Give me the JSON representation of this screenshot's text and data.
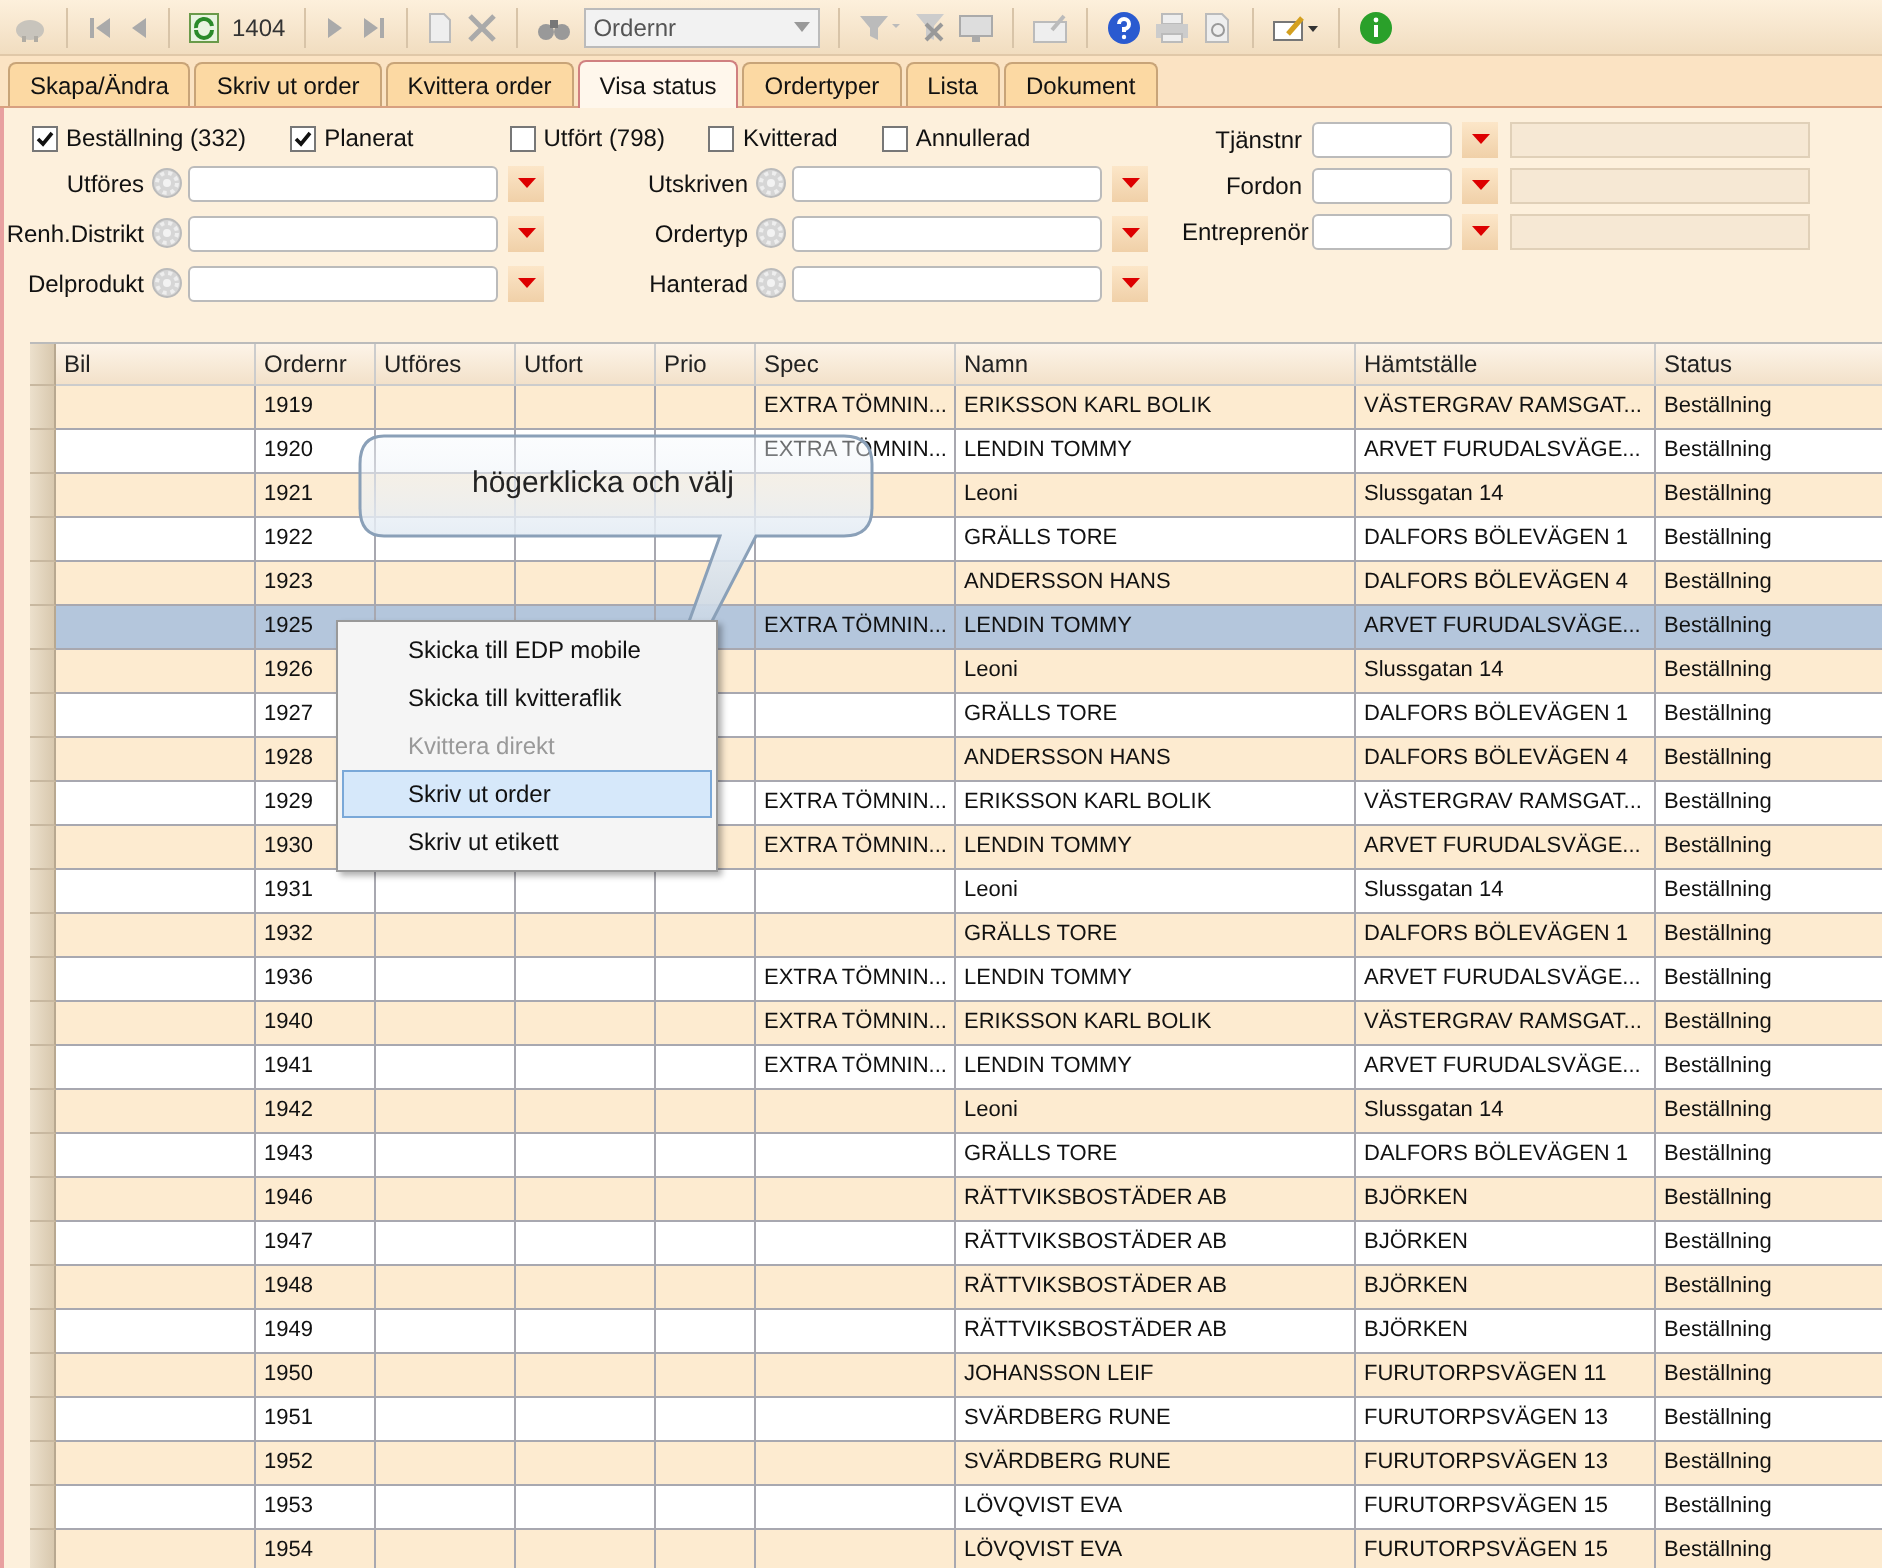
{
  "toolbar": {
    "record_count": "1404",
    "search_field": {
      "value": "Ordernr"
    }
  },
  "tabs": [
    {
      "label": "Skapa/Ändra",
      "selected": false
    },
    {
      "label": "Skriv ut order",
      "selected": false
    },
    {
      "label": "Kvittera order",
      "selected": false
    },
    {
      "label": "Visa status",
      "selected": true
    },
    {
      "label": "Ordertyper",
      "selected": false
    },
    {
      "label": "Lista",
      "selected": false
    },
    {
      "label": "Dokument",
      "selected": false
    }
  ],
  "status_checkboxes": [
    {
      "label": "Beställning (332)",
      "checked": true
    },
    {
      "label": "Planerat",
      "checked": true
    },
    {
      "label": "Utfört (798)",
      "checked": false
    },
    {
      "label": "Kvitterad",
      "checked": false
    },
    {
      "label": "Annullerad",
      "checked": false
    }
  ],
  "filters_left": [
    {
      "label": "Utföres"
    },
    {
      "label": "Renh.Distrikt"
    },
    {
      "label": "Delprodukt"
    }
  ],
  "filters_middle": [
    {
      "label": "Utskriven"
    },
    {
      "label": "Ordertyp"
    },
    {
      "label": "Hanterad"
    }
  ],
  "filters_right": [
    {
      "label": "Tjänstnr"
    },
    {
      "label": "Fordon"
    },
    {
      "label": "Entreprenör"
    }
  ],
  "table": {
    "columns": [
      "Bil",
      "Ordernr",
      "Utföres",
      "Utfort",
      "Prio",
      "Spec",
      "Namn",
      "Hämtställe",
      "Status"
    ],
    "rows": [
      {
        "ordernr": "1919",
        "spec": "EXTRA TÖMNIN...",
        "namn": "ERIKSSON KARL BOLIK",
        "hamtstalle": "VÄSTERGRAV RAMSGAT...",
        "status": "Beställning",
        "selected": false
      },
      {
        "ordernr": "1920",
        "spec": "EXTRA TÖMNIN...",
        "namn": "LENDIN TOMMY",
        "hamtstalle": "ARVET FURUDALSVÄGE...",
        "status": "Beställning",
        "selected": false
      },
      {
        "ordernr": "1921",
        "namn": "Leoni",
        "hamtstalle": "Slussgatan 14",
        "status": "Beställning",
        "selected": false
      },
      {
        "ordernr": "1922",
        "namn": "GRÄLLS TORE",
        "hamtstalle": "DALFORS BÖLEVÄGEN 1",
        "status": "Beställning",
        "selected": false
      },
      {
        "ordernr": "1923",
        "namn": "ANDERSSON HANS",
        "hamtstalle": "DALFORS BÖLEVÄGEN 4",
        "status": "Beställning",
        "selected": false
      },
      {
        "ordernr": "1925",
        "spec": "EXTRA TÖMNIN...",
        "namn": "LENDIN TOMMY",
        "hamtstalle": "ARVET FURUDALSVÄGE...",
        "status": "Beställning",
        "selected": true
      },
      {
        "ordernr": "1926",
        "namn": "Leoni",
        "hamtstalle": "Slussgatan 14",
        "status": "Beställning",
        "selected": false
      },
      {
        "ordernr": "1927",
        "namn": "GRÄLLS TORE",
        "hamtstalle": "DALFORS BÖLEVÄGEN 1",
        "status": "Beställning",
        "selected": false
      },
      {
        "ordernr": "1928",
        "namn": "ANDERSSON HANS",
        "hamtstalle": "DALFORS BÖLEVÄGEN 4",
        "status": "Beställning",
        "selected": false
      },
      {
        "ordernr": "1929",
        "spec": "EXTRA TÖMNIN...",
        "namn": "ERIKSSON KARL BOLIK",
        "hamtstalle": "VÄSTERGRAV RAMSGAT...",
        "status": "Beställning",
        "selected": false
      },
      {
        "ordernr": "1930",
        "spec": "EXTRA TÖMNIN...",
        "namn": "LENDIN TOMMY",
        "hamtstalle": "ARVET FURUDALSVÄGE...",
        "status": "Beställning",
        "selected": false
      },
      {
        "ordernr": "1931",
        "namn": "Leoni",
        "hamtstalle": "Slussgatan 14",
        "status": "Beställning",
        "selected": false
      },
      {
        "ordernr": "1932",
        "namn": "GRÄLLS TORE",
        "hamtstalle": "DALFORS BÖLEVÄGEN 1",
        "status": "Beställning",
        "selected": false
      },
      {
        "ordernr": "1936",
        "spec": "EXTRA TÖMNIN...",
        "namn": "LENDIN TOMMY",
        "hamtstalle": "ARVET FURUDALSVÄGE...",
        "status": "Beställning",
        "selected": false
      },
      {
        "ordernr": "1940",
        "spec": "EXTRA TÖMNIN...",
        "namn": "ERIKSSON KARL BOLIK",
        "hamtstalle": "VÄSTERGRAV RAMSGAT...",
        "status": "Beställning",
        "selected": false
      },
      {
        "ordernr": "1941",
        "spec": "EXTRA TÖMNIN...",
        "namn": "LENDIN TOMMY",
        "hamtstalle": "ARVET FURUDALSVÄGE...",
        "status": "Beställning",
        "selected": false
      },
      {
        "ordernr": "1942",
        "namn": "Leoni",
        "hamtstalle": "Slussgatan 14",
        "status": "Beställning",
        "selected": false
      },
      {
        "ordernr": "1943",
        "namn": "GRÄLLS TORE",
        "hamtstalle": "DALFORS BÖLEVÄGEN 1",
        "status": "Beställning",
        "selected": false
      },
      {
        "ordernr": "1946",
        "namn": "RÄTTVIKSBOSTÄDER AB",
        "hamtstalle": "BJÖRKEN",
        "status": "Beställning",
        "selected": false
      },
      {
        "ordernr": "1947",
        "namn": "RÄTTVIKSBOSTÄDER AB",
        "hamtstalle": "BJÖRKEN",
        "status": "Beställning",
        "selected": false
      },
      {
        "ordernr": "1948",
        "namn": "RÄTTVIKSBOSTÄDER AB",
        "hamtstalle": "BJÖRKEN",
        "status": "Beställning",
        "selected": false
      },
      {
        "ordernr": "1949",
        "namn": "RÄTTVIKSBOSTÄDER AB",
        "hamtstalle": "BJÖRKEN",
        "status": "Beställning",
        "selected": false
      },
      {
        "ordernr": "1950",
        "namn": "JOHANSSON LEIF",
        "hamtstalle": "FURUTORPSVÄGEN 11",
        "status": "Beställning",
        "selected": false
      },
      {
        "ordernr": "1951",
        "namn": "SVÄRDBERG RUNE",
        "hamtstalle": "FURUTORPSVÄGEN 13",
        "status": "Beställning",
        "selected": false
      },
      {
        "ordernr": "1952",
        "namn": "SVÄRDBERG RUNE",
        "hamtstalle": "FURUTORPSVÄGEN 13",
        "status": "Beställning",
        "selected": false
      },
      {
        "ordernr": "1953",
        "namn": "LÖVQVIST EVA",
        "hamtstalle": "FURUTORPSVÄGEN 15",
        "status": "Beställning",
        "selected": false
      },
      {
        "ordernr": "1954",
        "namn": "LÖVQVIST EVA",
        "hamtstalle": "FURUTORPSVÄGEN 15",
        "status": "Beställning",
        "selected": false
      }
    ]
  },
  "callout": {
    "text": "högerklicka och välj"
  },
  "context_menu": {
    "items": [
      {
        "label": "Skicka till EDP mobile",
        "disabled": false,
        "selected": false
      },
      {
        "label": "Skicka till kvitteraflik",
        "disabled": false,
        "selected": false
      },
      {
        "label": "Kvittera direkt",
        "disabled": true,
        "selected": false
      },
      {
        "label": "Skriv ut order",
        "disabled": false,
        "selected": true
      },
      {
        "label": "Skriv ut etikett",
        "disabled": false,
        "selected": false
      }
    ]
  }
}
